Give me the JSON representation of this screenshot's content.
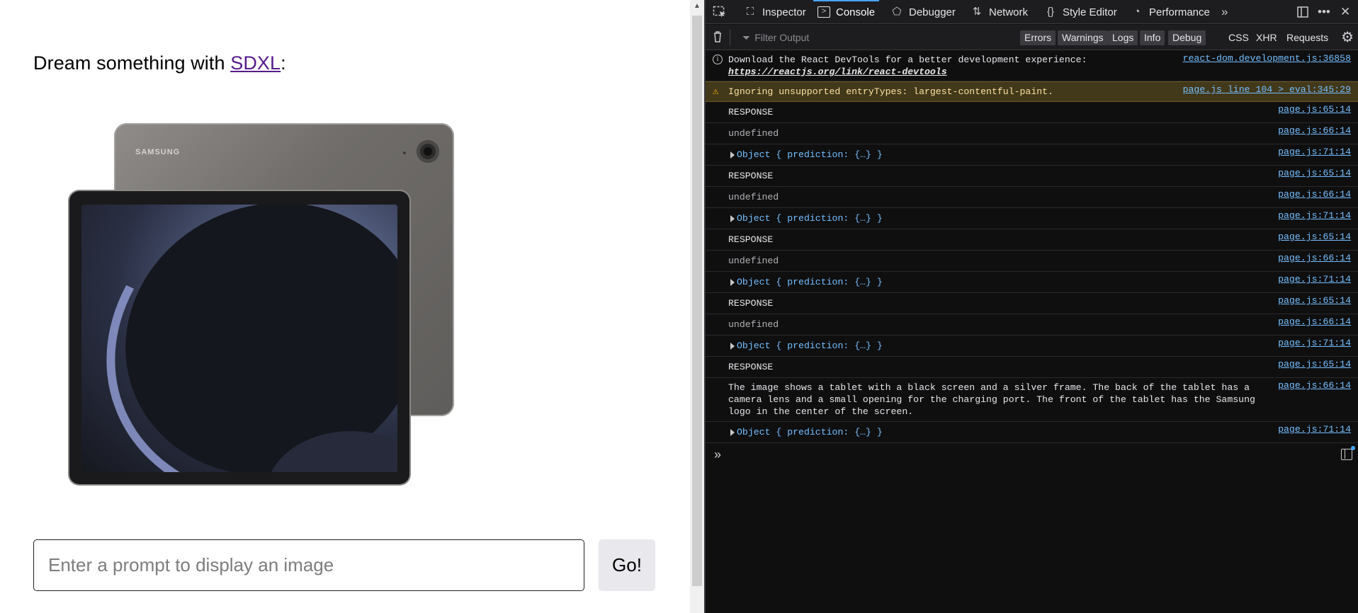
{
  "page": {
    "heading_prefix": "Dream something with ",
    "heading_link": "SDXL",
    "heading_suffix": ":",
    "image_brand_text": "SAMSUNG",
    "prompt_placeholder": "Enter a prompt to display an image",
    "go_label": "Go!"
  },
  "devtools": {
    "tabs": [
      {
        "label": "Inspector",
        "icon": "inspector-icon"
      },
      {
        "label": "Console",
        "icon": "console-icon",
        "active": true
      },
      {
        "label": "Debugger",
        "icon": "debugger-icon"
      },
      {
        "label": "Network",
        "icon": "network-icon"
      },
      {
        "label": "Style Editor",
        "icon": "style-editor-icon"
      },
      {
        "label": "Performance",
        "icon": "performance-icon"
      }
    ],
    "filter_placeholder": "Filter Output",
    "levels": [
      "Errors",
      "Warnings",
      "Logs",
      "Info",
      "Debug"
    ],
    "tags": [
      "CSS",
      "XHR",
      "Requests"
    ],
    "accent_color": "#4aa3ff",
    "link_color": "#75bfff",
    "log": [
      {
        "type": "info",
        "text": "Download the React DevTools for a better development experience: ",
        "link": "https://reactjs.org/link/react-devtools",
        "source": "react-dom.development.js:36858"
      },
      {
        "type": "warn",
        "text": "Ignoring unsupported entryTypes: largest-contentful-paint.",
        "source": "page.js line 104 > eval:345:29"
      },
      {
        "type": "plain",
        "text": "RESPONSE",
        "source": "page.js:65:14"
      },
      {
        "type": "undef",
        "text": "undefined",
        "source": "page.js:66:14"
      },
      {
        "type": "obj",
        "text": "Object { prediction: {…} }",
        "source": "page.js:71:14"
      },
      {
        "type": "plain",
        "text": "RESPONSE",
        "source": "page.js:65:14"
      },
      {
        "type": "undef",
        "text": "undefined",
        "source": "page.js:66:14"
      },
      {
        "type": "obj",
        "text": "Object { prediction: {…} }",
        "source": "page.js:71:14"
      },
      {
        "type": "plain",
        "text": "RESPONSE",
        "source": "page.js:65:14"
      },
      {
        "type": "undef",
        "text": "undefined",
        "source": "page.js:66:14"
      },
      {
        "type": "obj",
        "text": "Object { prediction: {…} }",
        "source": "page.js:71:14"
      },
      {
        "type": "plain",
        "text": "RESPONSE",
        "source": "page.js:65:14"
      },
      {
        "type": "undef",
        "text": "undefined",
        "source": "page.js:66:14"
      },
      {
        "type": "obj",
        "text": "Object { prediction: {…} }",
        "source": "page.js:71:14"
      },
      {
        "type": "plain",
        "text": "RESPONSE",
        "source": "page.js:65:14"
      },
      {
        "type": "long",
        "text": "The image shows a tablet with a black screen and a silver frame. The back of the tablet has a camera lens and a small opening for the charging port. The front of the tablet has the Samsung logo in the center of the screen.",
        "source": "page.js:66:14"
      },
      {
        "type": "obj",
        "text": "Object { prediction: {…} }",
        "source": "page.js:71:14"
      }
    ]
  }
}
